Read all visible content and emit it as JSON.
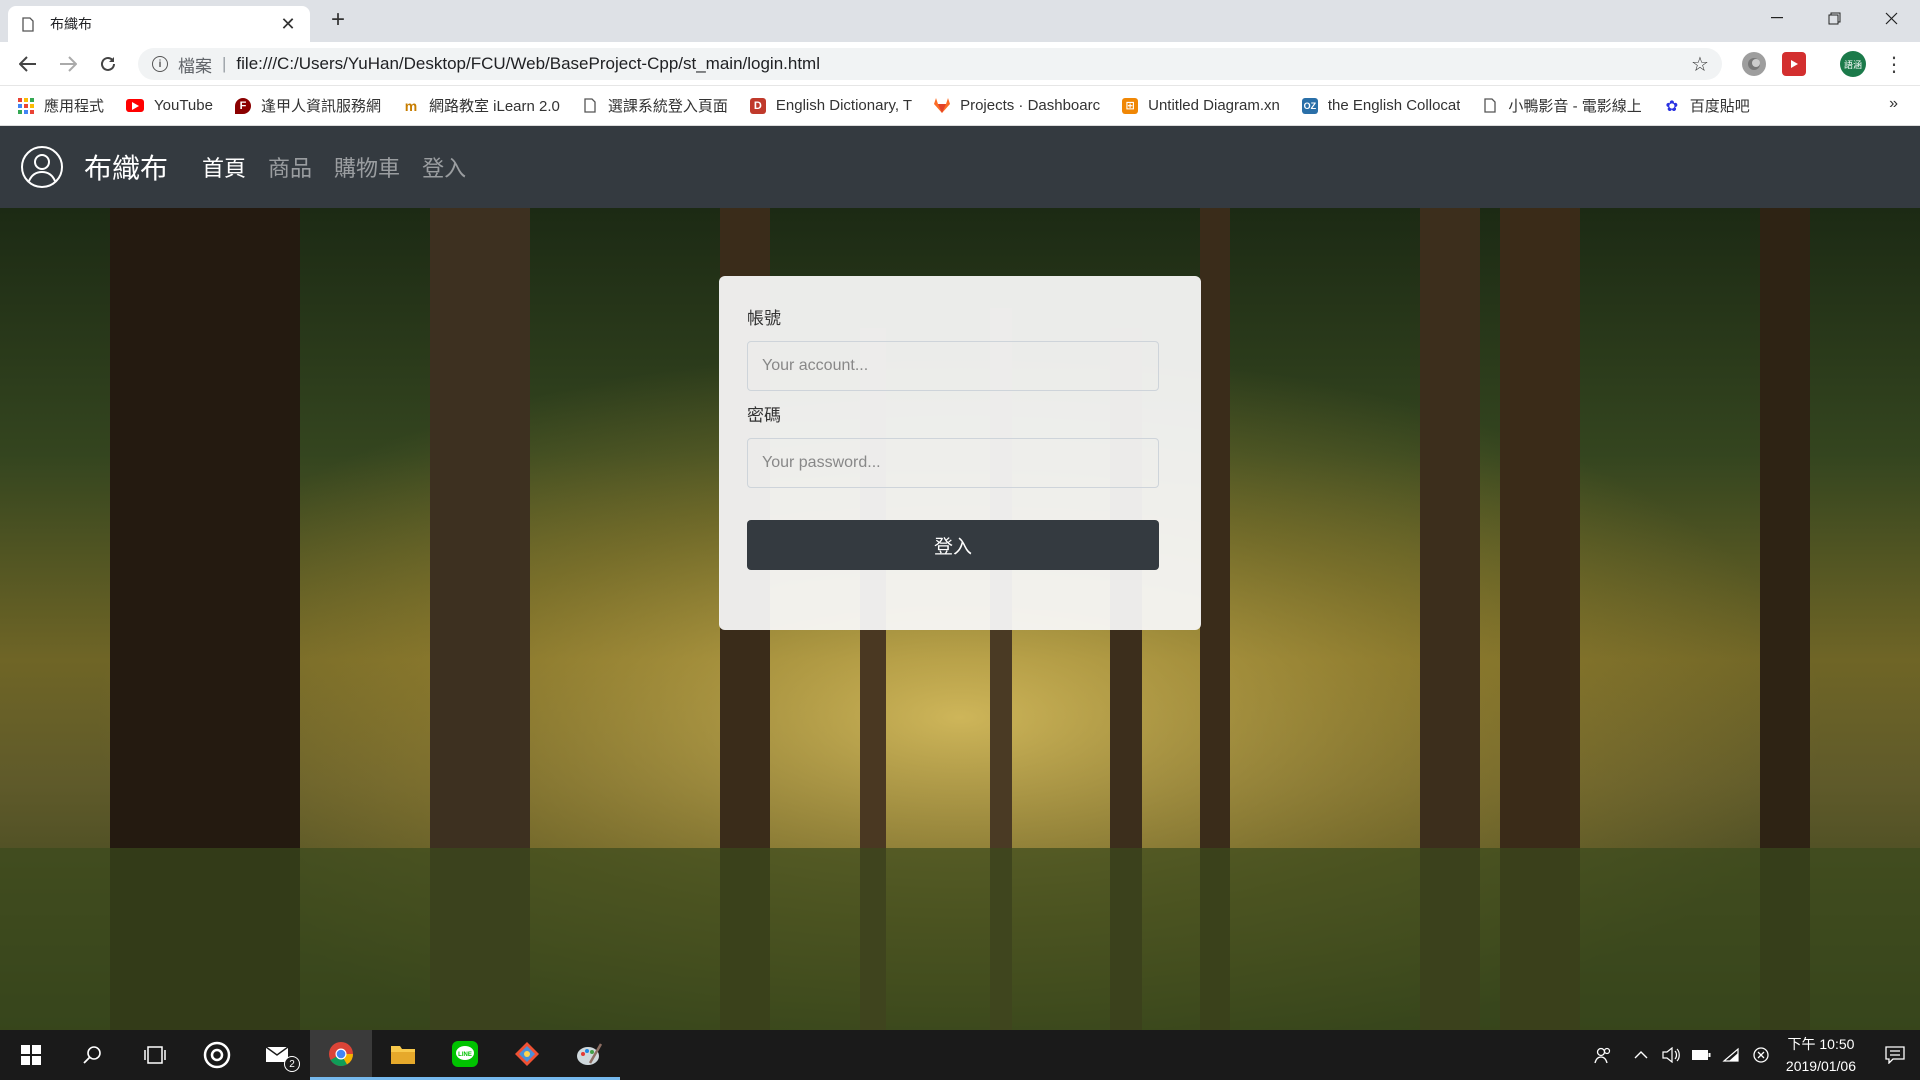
{
  "browser": {
    "tab_title": "布織布",
    "url_scheme": "檔案",
    "url": "file:///C:/Users/YuHan/Desktop/FCU/Web/BaseProject-Cpp/st_main/login.html",
    "profile_initials": "語涵"
  },
  "bookmarks": [
    {
      "label": "應用程式",
      "icon": "apps-grid-icon"
    },
    {
      "label": "YouTube",
      "icon": "youtube-icon"
    },
    {
      "label": "逢甲人資訊服務網",
      "icon": "fcu-icon"
    },
    {
      "label": "網路教室 iLearn 2.0",
      "icon": "ilearn-icon"
    },
    {
      "label": "選課系統登入頁面",
      "icon": "page-icon"
    },
    {
      "label": "English Dictionary, T",
      "icon": "dictionary-icon"
    },
    {
      "label": "Projects · Dashboarc",
      "icon": "gitlab-icon"
    },
    {
      "label": "Untitled Diagram.xn",
      "icon": "drawio-icon"
    },
    {
      "label": "the English Collocat",
      "icon": "ozdic-icon"
    },
    {
      "label": "小鴨影音 - 電影線上",
      "icon": "page-icon"
    },
    {
      "label": "百度貼吧",
      "icon": "baidu-icon"
    }
  ],
  "site": {
    "brand": "布織布",
    "nav": [
      {
        "label": "首頁",
        "active": true
      },
      {
        "label": "商品",
        "active": false
      },
      {
        "label": "購物車",
        "active": false
      },
      {
        "label": "登入",
        "active": false
      }
    ]
  },
  "login": {
    "account_label": "帳號",
    "account_placeholder": "Your account...",
    "password_label": "密碼",
    "password_placeholder": "Your password...",
    "submit_label": "登入"
  },
  "taskbar": {
    "time": "下午 10:50",
    "date": "2019/01/06",
    "mail_badge": "2"
  },
  "colors": {
    "navbar": "#343a40",
    "button": "#343a40",
    "tabbar": "#dee1e6"
  }
}
